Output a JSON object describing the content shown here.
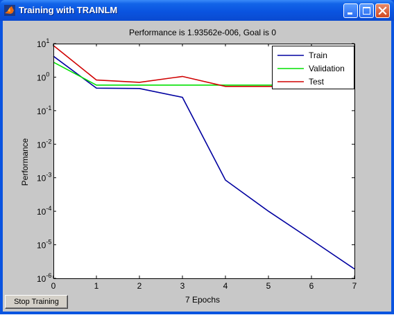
{
  "window": {
    "title": "Training with TRAINLM",
    "stop_button_label": "Stop Training"
  },
  "colors": {
    "titlebar": "#0a54e0",
    "client_bg": "#c8c8c8",
    "train": "#0000a0",
    "validation": "#00e000",
    "test": "#d00000"
  },
  "chart_data": {
    "type": "line",
    "title": "Performance is 1.93562e-006, Goal is 0",
    "xlabel": "7 Epochs",
    "ylabel": "Performance",
    "xlim": [
      0,
      7
    ],
    "ylim": [
      1e-06,
      10
    ],
    "yscale": "log",
    "x_ticks": [
      0,
      1,
      2,
      3,
      4,
      5,
      6,
      7
    ],
    "y_ticks": [
      1e-06,
      1e-05,
      0.0001,
      0.001,
      0.01,
      0.1,
      1,
      10
    ],
    "y_tick_labels": [
      {
        "base": "10",
        "exp": "-6"
      },
      {
        "base": "10",
        "exp": "-5"
      },
      {
        "base": "10",
        "exp": "-4"
      },
      {
        "base": "10",
        "exp": "-3"
      },
      {
        "base": "10",
        "exp": "-2"
      },
      {
        "base": "10",
        "exp": "-1"
      },
      {
        "base": "10",
        "exp": "0"
      },
      {
        "base": "10",
        "exp": "1"
      }
    ],
    "legend_position": "top-right",
    "x": [
      0,
      1,
      2,
      3,
      4,
      5,
      6,
      7
    ],
    "series": [
      {
        "name": "Train",
        "color": "#0000a0",
        "values": [
          4.2,
          0.47,
          0.46,
          0.25,
          0.00085,
          0.0001,
          1.4e-05,
          1.9e-06
        ]
      },
      {
        "name": "Validation",
        "color": "#00e000",
        "values": [
          2.8,
          0.58,
          0.58,
          0.58,
          0.58,
          0.58,
          0.58,
          0.58
        ]
      },
      {
        "name": "Test",
        "color": "#d00000",
        "values": [
          8.8,
          0.82,
          0.7,
          1.05,
          0.53,
          0.53,
          0.53,
          0.53
        ]
      }
    ]
  }
}
